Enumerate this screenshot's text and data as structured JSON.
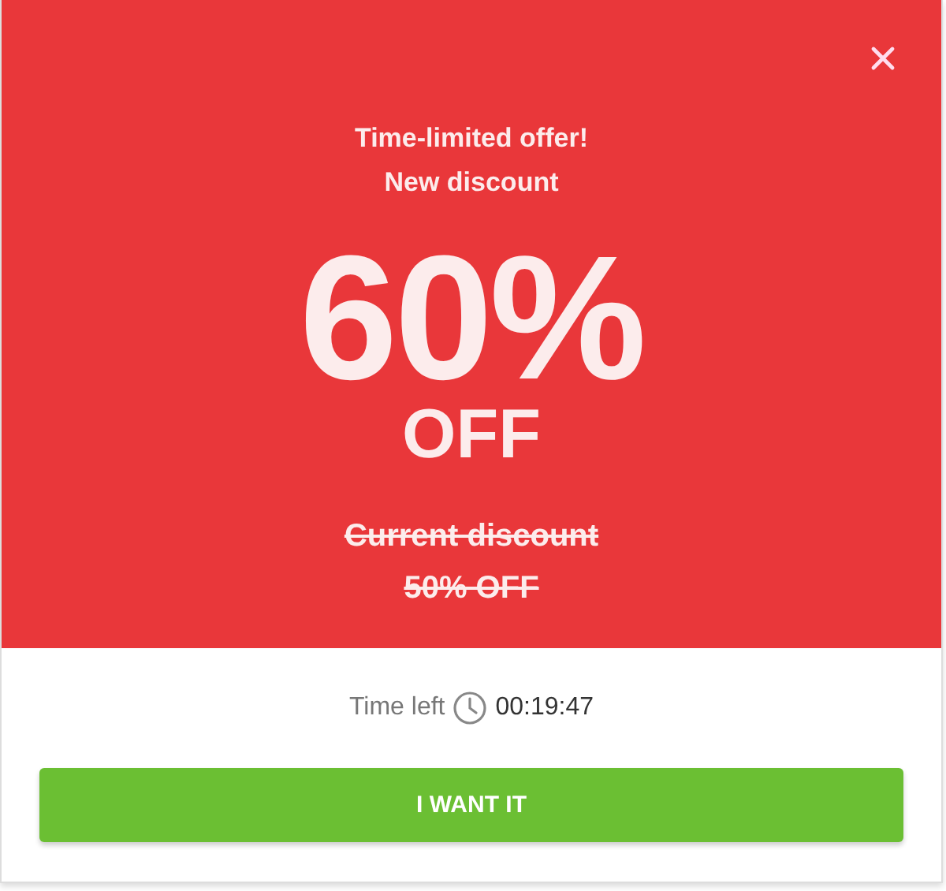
{
  "offer": {
    "headline": [
      "Time-limited offer!",
      "New discount"
    ],
    "discount": "60%",
    "discount_suffix": "OFF"
  },
  "old_offer": {
    "struck": true,
    "lines": [
      "Current discount",
      "50% OFF"
    ]
  },
  "timer": {
    "label": "Time left",
    "value": "00:19:47"
  },
  "button": {
    "label": "I WANT IT"
  }
}
